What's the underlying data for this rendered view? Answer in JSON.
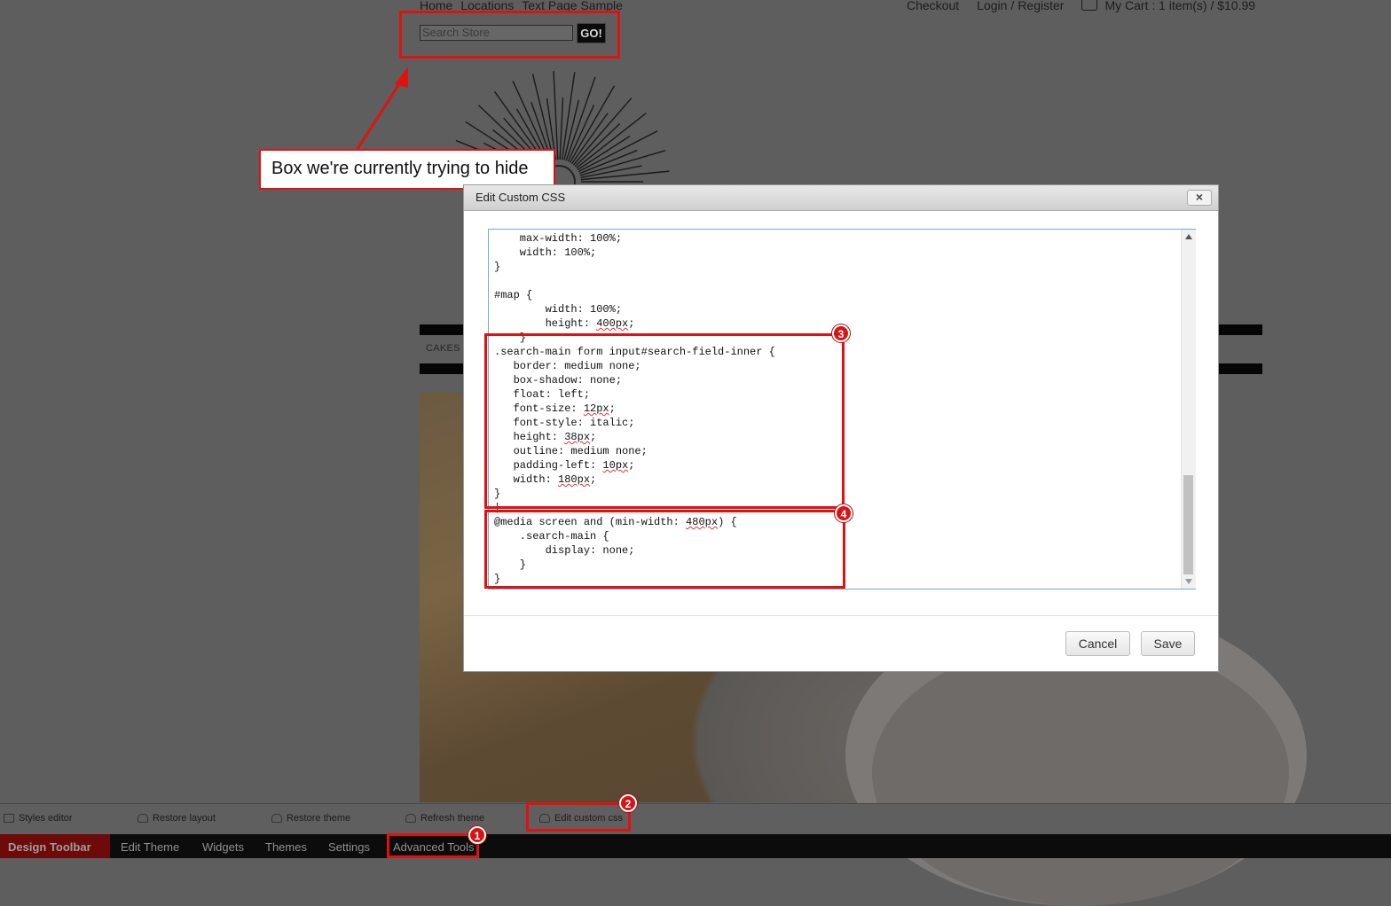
{
  "site": {
    "nav": [
      "Home",
      "Locations",
      "Text Page Sample"
    ],
    "right_nav": {
      "checkout": "Checkout",
      "login": "Login",
      "sep": "/",
      "register": "Register",
      "cart": "My Cart : 1 item(s) / $10.99"
    },
    "search": {
      "placeholder": "Search Store",
      "button": "GO!"
    },
    "menu_item": "CAKES"
  },
  "annotation": {
    "callout": "Box we're currently trying to hide",
    "badges": [
      "1",
      "2",
      "3",
      "4"
    ]
  },
  "modal": {
    "title": "Edit Custom CSS",
    "close": "×",
    "code": {
      "l1": "    max-width: 100%;",
      "l2": "    width: 100%;",
      "l3": "}",
      "l4": "",
      "l5": "#map {",
      "l6": "        width: 100%;",
      "l7a": "        height: ",
      "l7b": "400px",
      "l7c": ";",
      "l8": "    }",
      "l9": ".search-main form input#search-field-inner {",
      "l10": "   border: medium none;",
      "l11": "   box-shadow: none;",
      "l12": "   float: left;",
      "l13a": "   font-size: ",
      "l13b": "12px",
      "l13c": ";",
      "l14": "   font-style: italic;",
      "l15a": "   height: ",
      "l15b": "38px",
      "l15c": ";",
      "l16": "   outline: medium none;",
      "l17a": "   padding-left: ",
      "l17b": "10px",
      "l17c": ";",
      "l18a": "   width: ",
      "l18b": "180px",
      "l18c": ";",
      "l19": "}",
      "l20": "|",
      "l21a": "@media screen and (min-width: ",
      "l21b": "480px",
      "l21c": ") {",
      "l22": "    .search-main {",
      "l23": "        display: none;",
      "l24": "    }",
      "l25": "}"
    },
    "cancel": "Cancel",
    "save": "Save"
  },
  "toolbar_secondary": [
    "Styles editor",
    "Restore layout",
    "Restore theme",
    "Refresh theme",
    "Edit custom css"
  ],
  "toolbar_main": {
    "title": "Design Toolbar",
    "items": [
      "Edit Theme",
      "Widgets",
      "Themes",
      "Settings",
      "Advanced Tools"
    ]
  },
  "colors": {
    "annotation_red": "#e11111",
    "design_toolbar": "#6e0a0a"
  }
}
